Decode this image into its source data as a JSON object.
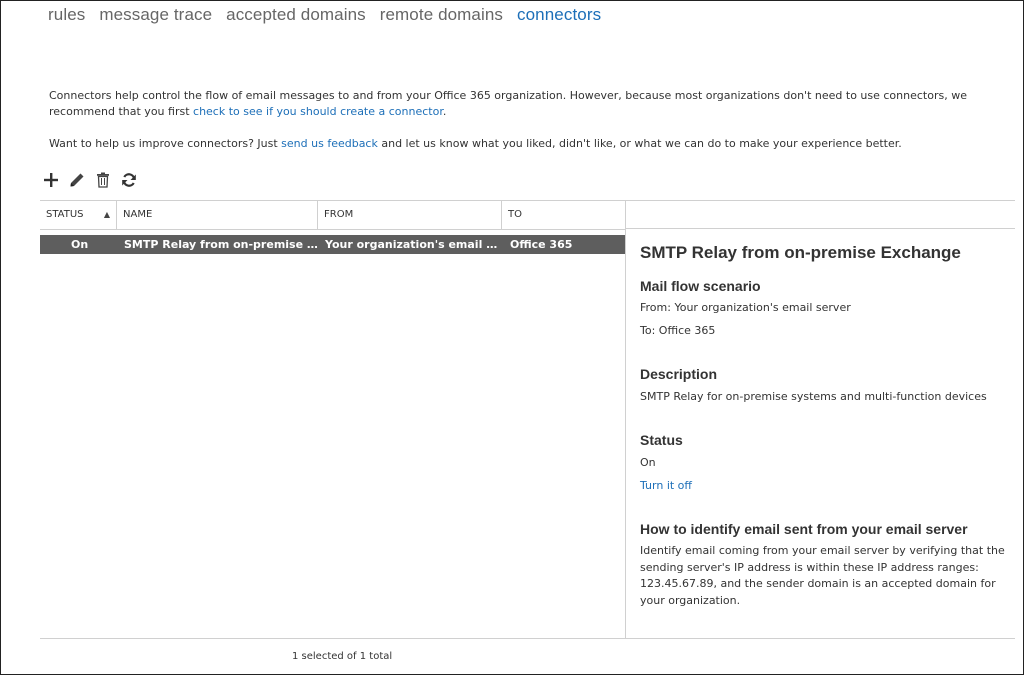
{
  "nav": {
    "tabs": [
      {
        "label": "rules",
        "active": false
      },
      {
        "label": "message trace",
        "active": false
      },
      {
        "label": "accepted domains",
        "active": false
      },
      {
        "label": "remote domains",
        "active": false
      },
      {
        "label": "connectors",
        "active": true
      }
    ]
  },
  "intro": {
    "line1_text": "Connectors help control the flow of email messages to and from your Office 365 organization. However, because most organizations don't need to use connectors, we recommend that you first ",
    "line1_link": "check to see if you should create a connector",
    "line1_end": ".",
    "line2_text": "Want to help us improve connectors? Just ",
    "line2_link": "send us feedback",
    "line2_end": " and let us know what you liked, didn't like, or what we can do to make your experience better."
  },
  "toolbar": {
    "icons": [
      "add-icon",
      "edit-icon",
      "delete-icon",
      "refresh-icon"
    ]
  },
  "table": {
    "columns": [
      "STATUS",
      "NAME",
      "FROM",
      "TO"
    ],
    "rows": [
      {
        "status": "On",
        "name": "SMTP Relay from on-premise Exch...",
        "from": "Your organization's email server",
        "to": "Office 365",
        "selected": true
      }
    ],
    "footer": "1 selected of 1 total"
  },
  "detail": {
    "title": "SMTP Relay from on-premise Exchange",
    "scenario_heading": "Mail flow scenario",
    "scenario_from": "From: Your organization's email server",
    "scenario_to": "To: Office 365",
    "description_heading": "Description",
    "description_text": "SMTP Relay for on-premise systems and multi-function devices",
    "status_heading": "Status",
    "status_value": "On",
    "status_action": "Turn it off",
    "identify_heading": "How to identify email sent from your email server",
    "identify_text": "Identify email coming from your email server by verifying that the sending server's IP address is within these IP address ranges: 123.45.67.89, and the sender domain is an accepted domain for your organization."
  },
  "colors": {
    "accent": "#1d6fb8",
    "selected_row": "#5e5e5e",
    "border": "#d0d0d0"
  }
}
